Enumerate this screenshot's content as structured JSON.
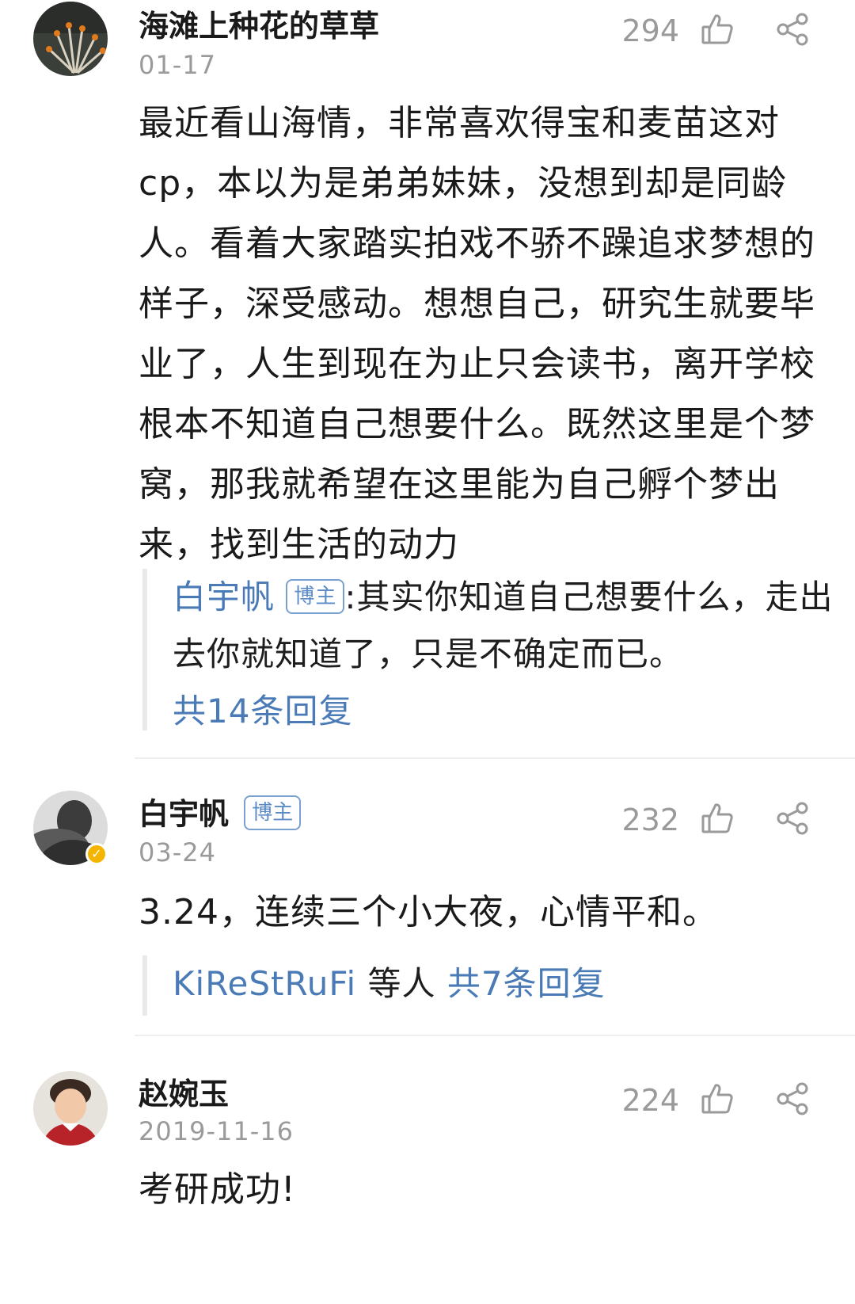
{
  "comments": [
    {
      "username": "海滩上种花的草草",
      "date": "01-17",
      "likes": "294",
      "text": "最近看山海情，非常喜欢得宝和麦苗这对cp，本以为是弟弟妹妹，没想到却是同龄人。看着大家踏实拍戏不骄不躁追求梦想的样子，深受感动。想想自己，研究生就要毕业了，人生到现在为止只会读书，离开学校根本不知道自己想要什么。既然这里是个梦窝，那我就希望在这里能为自己孵个梦出来，找到生活的动力",
      "reply": {
        "author": "白宇帆",
        "badge": "博主",
        "separator": ":",
        "text": "其实你知道自己想要什么，走出去你就知道了，只是不确定而已。",
        "more": "共14条回复"
      }
    },
    {
      "username": "白宇帆",
      "badge": "博主",
      "date": "03-24",
      "likes": "232",
      "text": "3.24，连续三个小大夜，心情平和。",
      "reply": {
        "author": "KiReStRuFi",
        "middle": "等人",
        "more": "共7条回复"
      }
    },
    {
      "username": "赵婉玉",
      "date": "2019-11-16",
      "likes": "224",
      "text": "考研成功!"
    }
  ],
  "icons": {
    "like": "thumbs-up-icon",
    "share": "share-icon",
    "verified": "verified-badge-icon"
  },
  "colors": {
    "link": "#4a7bb7",
    "muted": "#9a9a9a",
    "verified": "#f5b400"
  }
}
